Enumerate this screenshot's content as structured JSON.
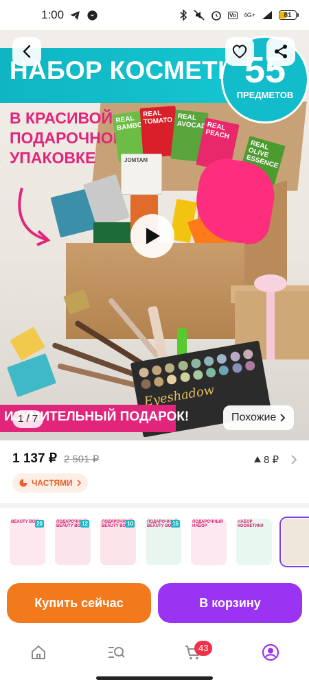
{
  "status_bar": {
    "time": "1:00",
    "network": "4G+",
    "battery": "81"
  },
  "hero": {
    "title": "НАБОР КОСМЕТИКИ",
    "badge_number": "55",
    "badge_label": "ПРЕДМЕТОВ",
    "tagline": [
      "В КРАСИВОЙ",
      "ПОДАРОЧНОЙ",
      "УПАКОВКЕ"
    ],
    "bottom_banner": "ИЗУМИТЕЛЬНЫЙ ПОДАРОК!",
    "counter": "1 / 7",
    "similar_label": "Похожие",
    "packs": [
      "REAL BAMBOO",
      "REAL TOMATO",
      "REAL AVOCADO",
      "REAL PEACH",
      "REAL OLIVE ESSENCE",
      "JOMTAM"
    ],
    "palette_text": "Eyeshadow"
  },
  "product": {
    "price_current": "1 137 ₽",
    "price_old": "2 501 ₽",
    "rating": "8 ₽",
    "installments_label": "ЧАСТЯМИ"
  },
  "variants": [
    {
      "label": "BEAUTY BOX",
      "num": "20",
      "color": "#fde8ef"
    },
    {
      "label": "ПОДАРОЧНЫЙ BEAUTY BOX",
      "num": "12",
      "color": "#fce4ec"
    },
    {
      "label": "ПОДАРОЧНЫЙ BEAUTY BOX",
      "num": "10",
      "color": "#fbe3ea"
    },
    {
      "label": "ПОДАРОЧНЫЙ BEAUTY BOX",
      "num": "15",
      "color": "#e9f6f0"
    },
    {
      "label": "ПОДАРОЧНЫЙ НАБОР",
      "num": "",
      "color": "#fde7f0"
    },
    {
      "label": "НАБОР КОСМЕТИКИ",
      "num": "",
      "color": "#e8f7ef"
    },
    {
      "label": "",
      "num": "",
      "color": "#efe6dc"
    }
  ],
  "actions": {
    "buy_now": "Купить сейчас",
    "add_to_cart": "В корзину"
  },
  "tabbar": {
    "cart_badge": "43"
  },
  "colors": {
    "accent_orange": "#f2791c",
    "accent_purple": "#9a33f2",
    "brand_pink": "#e0257a",
    "brand_teal": "#13bccb"
  }
}
